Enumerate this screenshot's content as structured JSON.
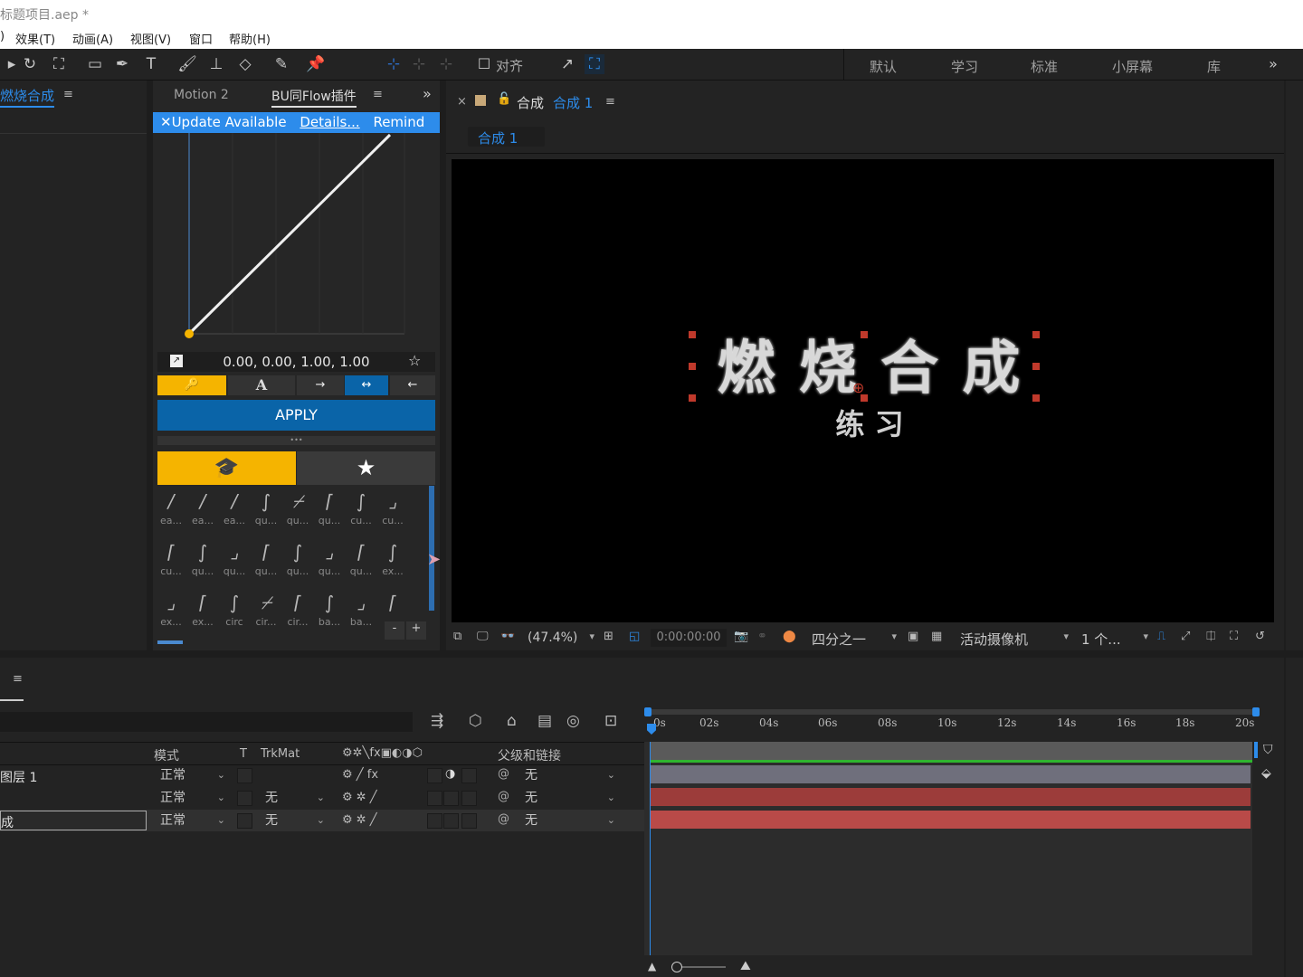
{
  "title": "标题项目.aep *",
  "title_visible": "标题项目.aep *",
  "menu": [
    "效果(T)",
    "动画(A)",
    "视图(V)",
    "窗口",
    "帮助(H)"
  ],
  "menu_partial_left": ")",
  "toolbar": {
    "align_label": "对齐",
    "workspaces": [
      "默认",
      "学习",
      "标准",
      "小屏幕",
      "库"
    ]
  },
  "project_panel": {
    "tab_label": "燃烧合成"
  },
  "plugin_panel": {
    "tab1": "Motion 2",
    "tab2": "BU同Flow插件",
    "update_text": "Update Available",
    "details": "Details...",
    "remind": "Remind",
    "values": "0.00, 0.00, 1.00, 1.00",
    "apply": "APPLY",
    "handle": "•••",
    "ease_row1": [
      "ea...",
      "ea...",
      "ea...",
      "qu...",
      "qu...",
      "qu...",
      "cu...",
      "cu..."
    ],
    "ease_row2": [
      "cu...",
      "qu...",
      "qu...",
      "qu...",
      "qu...",
      "qu...",
      "qu...",
      "ex..."
    ],
    "ease_row3": [
      "ex...",
      "ex...",
      "circ",
      "cir...",
      "cir...",
      "ba...",
      "ba...",
      ""
    ],
    "minus": "-",
    "plus": "+"
  },
  "comp_panel": {
    "close": "×",
    "title_prefix": "合成",
    "title_name": "合成 1",
    "sub_tab": "合成 1",
    "main_text": "燃 烧 合 成",
    "sub_text": "练 习",
    "zoom": "(47.4%)",
    "timecode": "0:00:00:00",
    "resolution": "四分之一",
    "camera": "活动摄像机",
    "views": "1 个..."
  },
  "timeline": {
    "menu_icon": "≡",
    "col_mode": "模式",
    "col_t": "T",
    "col_trkmat": "TrkMat",
    "col_parent": "父级和链接",
    "ticks": [
      "0s",
      "02s",
      "04s",
      "06s",
      "08s",
      "10s",
      "12s",
      "14s",
      "16s",
      "18s",
      "20s"
    ],
    "layers": [
      {
        "name": "图层 1",
        "mode": "正常",
        "trkmat": "",
        "parent": "无"
      },
      {
        "name": "",
        "mode": "正常",
        "trkmat": "无",
        "parent": "无"
      },
      {
        "name": "成",
        "mode": "正常",
        "trkmat": "无",
        "parent": "无"
      }
    ]
  },
  "colors": {
    "accent": "#2d8ceb",
    "yellow": "#f5b400",
    "apply": "#0a64a8",
    "bar_gray": "#6f6f7c",
    "bar_red": "#b94a48"
  }
}
